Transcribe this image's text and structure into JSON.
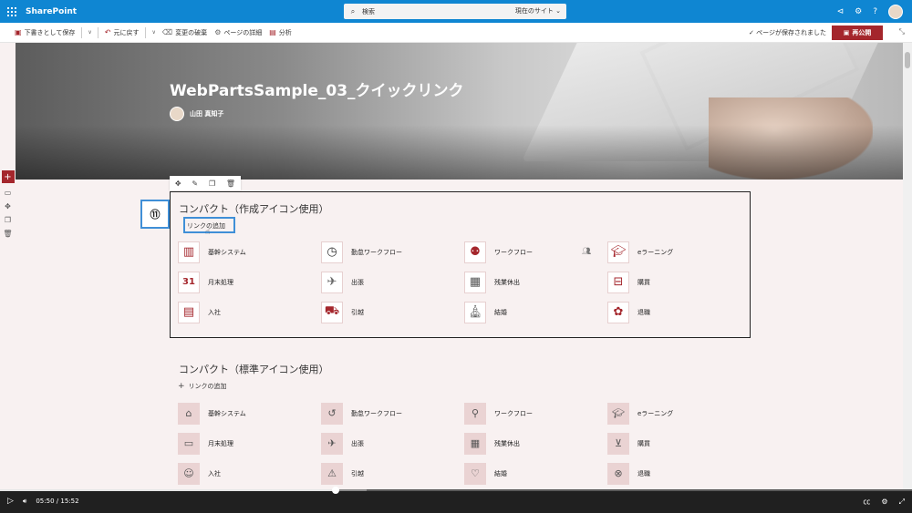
{
  "suite": {
    "brand": "SharePoint",
    "search_placeholder": "検索",
    "search_scope": "現在のサイト"
  },
  "commands": {
    "save_draft": "下書きとして保存",
    "undo": "元に戻す",
    "discard": "変更の破棄",
    "page_details": "ページの詳細",
    "analytics": "分析",
    "saved_status": "ページが保存されました",
    "republish": "再公開"
  },
  "hero": {
    "title": "WebPartsSample_03_クイックリンク",
    "author": "山田 真知子"
  },
  "annotation": {
    "number": "⑪"
  },
  "webpart1": {
    "title": "コンパクト（作成アイコン使用）",
    "add_link": "リンクの追加",
    "items": [
      {
        "label": "基幹システム",
        "icon": "building-icon"
      },
      {
        "label": "勤怠ワークフロー",
        "icon": "clock-icon"
      },
      {
        "label": "ワークフロー",
        "icon": "workflow-icon"
      },
      {
        "label": "eラーニング",
        "icon": "elearning-icon"
      },
      {
        "label": "月末処理",
        "icon": "calendar-icon"
      },
      {
        "label": "出張",
        "icon": "airplane-icon"
      },
      {
        "label": "残業休出",
        "icon": "schedule-icon"
      },
      {
        "label": "購買",
        "icon": "basket-icon"
      },
      {
        "label": "入社",
        "icon": "new-employee-icon"
      },
      {
        "label": "引越",
        "icon": "moving-truck-icon"
      },
      {
        "label": "結婚",
        "icon": "church-icon"
      },
      {
        "label": "退職",
        "icon": "bouquet-icon"
      }
    ]
  },
  "webpart2": {
    "title": "コンパクト（標準アイコン使用）",
    "add_link": "リンクの追加",
    "items": [
      {
        "label": "基幹システム",
        "icon": "city-icon"
      },
      {
        "label": "勤怠ワークフロー",
        "icon": "history-icon"
      },
      {
        "label": "ワークフロー",
        "icon": "flow-icon"
      },
      {
        "label": "eラーニング",
        "icon": "education-icon"
      },
      {
        "label": "月末処理",
        "icon": "payment-card-icon"
      },
      {
        "label": "出張",
        "icon": "airplane-icon"
      },
      {
        "label": "残業休出",
        "icon": "timesheet-icon"
      },
      {
        "label": "購買",
        "icon": "shopping-cart-icon"
      },
      {
        "label": "入社",
        "icon": "add-person-icon"
      },
      {
        "label": "引越",
        "icon": "moving-icon"
      },
      {
        "label": "結婚",
        "icon": "heart-person-icon"
      },
      {
        "label": "退職",
        "icon": "remove-person-icon"
      }
    ]
  },
  "video": {
    "current_time": "05:50",
    "separator": "/",
    "duration": "15:52",
    "progress": 0.368,
    "buffered": 0.402
  },
  "colors": {
    "suite_bar": "#0f86d2",
    "accent": "#a4262c",
    "callout": "#3f8fd7"
  }
}
